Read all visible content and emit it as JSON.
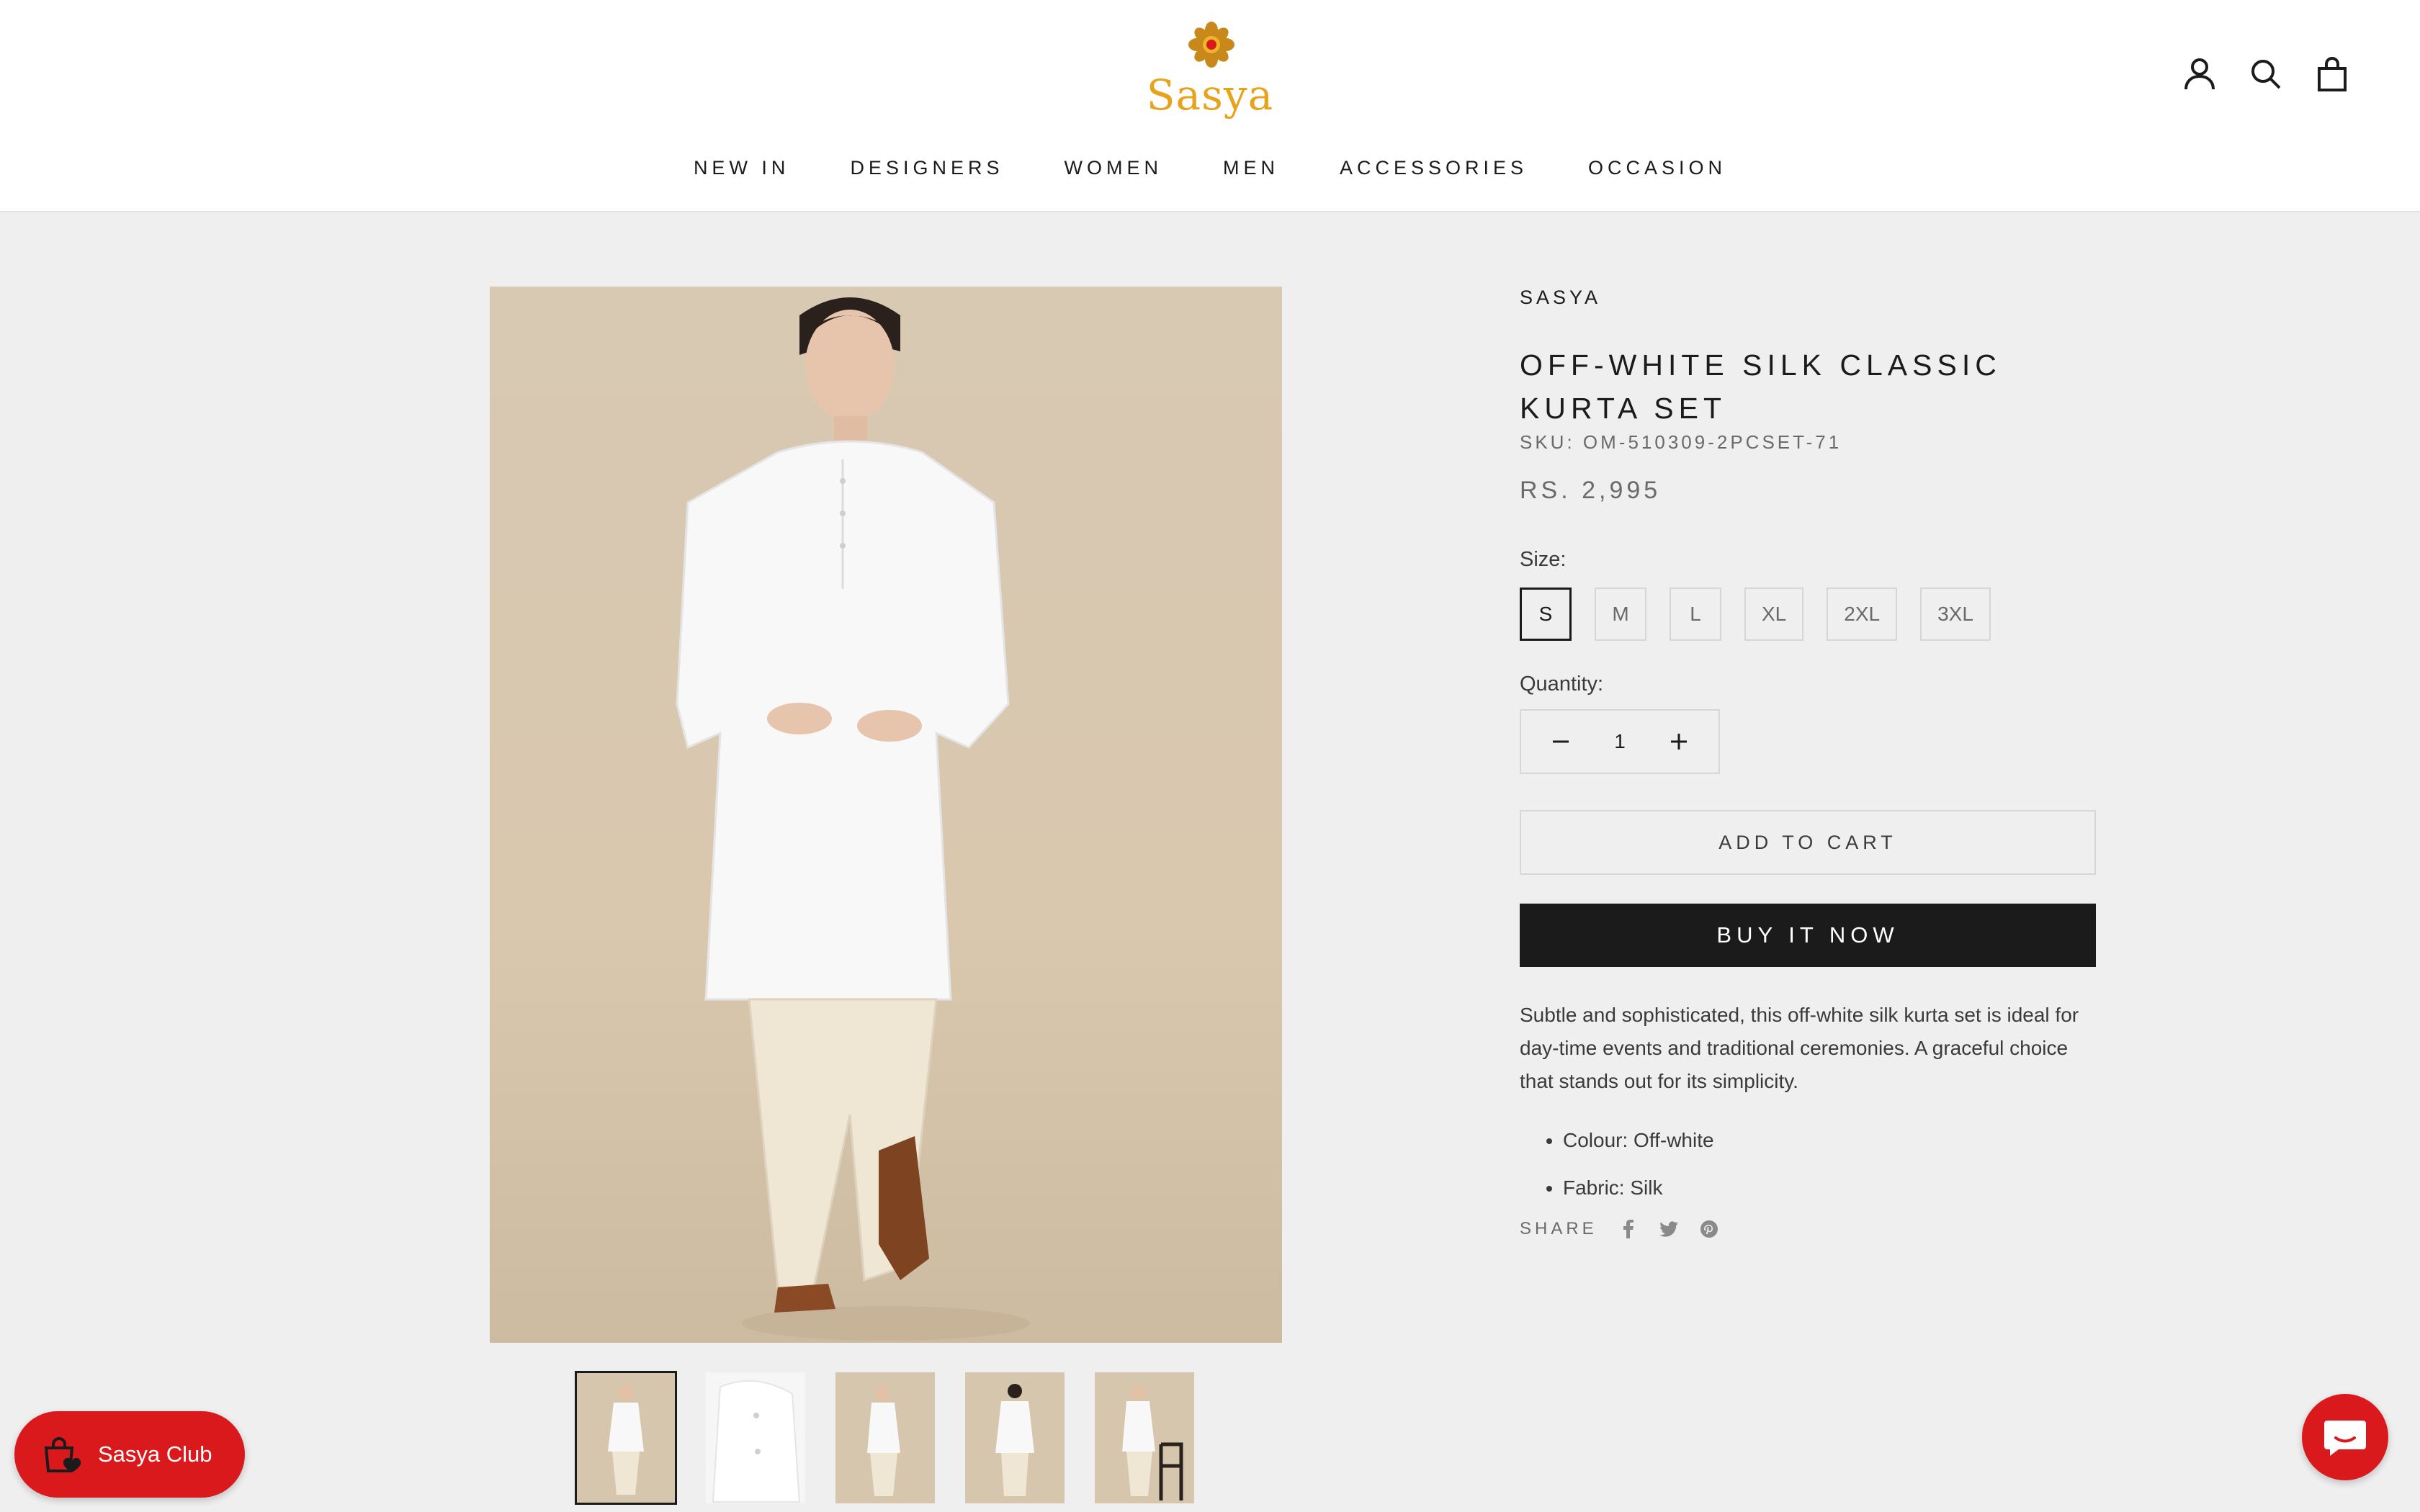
{
  "brand": {
    "name": "Sasya",
    "logo_icon": "lotus-flower-icon",
    "accent": "#e8a31c"
  },
  "header_icons": [
    "account-icon",
    "search-icon",
    "cart-bag-icon"
  ],
  "nav": [
    {
      "label": "NEW IN"
    },
    {
      "label": "DESIGNERS"
    },
    {
      "label": "WOMEN"
    },
    {
      "label": "MEN"
    },
    {
      "label": "ACCESSORIES"
    },
    {
      "label": "OCCASION"
    }
  ],
  "product": {
    "vendor": "SASYA",
    "title": "OFF-WHITE SILK CLASSIC KURTA SET",
    "sku": "SKU: OM-510309-2PCSET-71",
    "price": "RS. 2,995",
    "size_label": "Size:",
    "sizes": [
      "S",
      "M",
      "L",
      "XL",
      "2XL",
      "3XL"
    ],
    "selected_size": "S",
    "quantity_label": "Quantity:",
    "quantity": "1",
    "add_to_cart": "ADD TO CART",
    "buy_now": "BUY IT NOW",
    "description": "Subtle and sophisticated, this off-white silk kurta set is ideal for day-time events and traditional ceremonies. A graceful choice that stands out for its simplicity.",
    "details": [
      "Colour: Off-white",
      "Fabric: Silk"
    ],
    "share_label": "SHARE",
    "share_icons": [
      "facebook-icon",
      "twitter-icon",
      "pinterest-icon"
    ],
    "thumbnail_count": 5
  },
  "widgets": {
    "club_label": "Sasya Club",
    "club_color": "#d9191c",
    "chat_icon": "chat-bubble-icon"
  }
}
